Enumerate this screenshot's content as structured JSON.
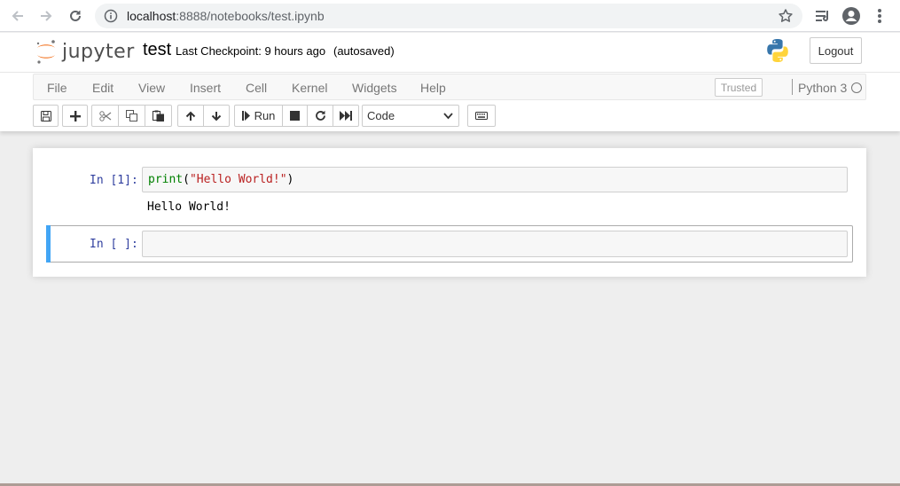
{
  "browser": {
    "url_host": "localhost",
    "url_rest": ":8888/notebooks/test.ipynb"
  },
  "header": {
    "logo_text": "jupyter",
    "notebook_title": "test",
    "checkpoint": "Last Checkpoint: 9 hours ago",
    "autosave_status": "(autosaved)",
    "logout_label": "Logout"
  },
  "menubar": {
    "items": [
      "File",
      "Edit",
      "View",
      "Insert",
      "Cell",
      "Kernel",
      "Widgets",
      "Help"
    ],
    "trusted_label": "Trusted",
    "kernel_name": "Python 3"
  },
  "toolbar": {
    "run_label": "Run",
    "cell_type": "Code"
  },
  "cells": [
    {
      "prompt": "In [1]:",
      "code_builtin": "print",
      "code_open": "(",
      "code_string": "\"Hello World!\"",
      "code_close": ")",
      "output": "Hello World!"
    },
    {
      "prompt": "In [ ]:",
      "code": ""
    }
  ],
  "colors": {
    "accent_selected": "#42a5f5",
    "prompt": "#303f9f",
    "jupyter_orange": "#f37726"
  }
}
